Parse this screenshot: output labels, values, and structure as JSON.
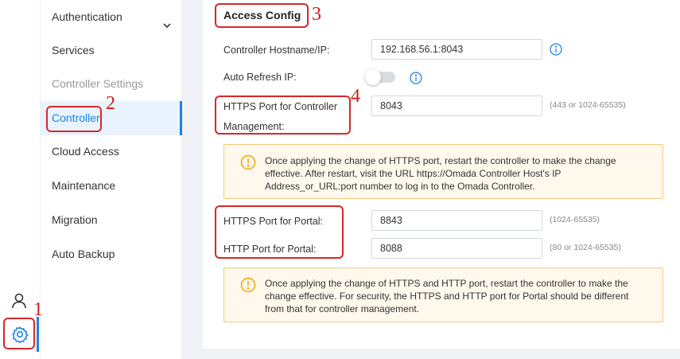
{
  "colors": {
    "accent": "#1d82e6",
    "annotation": "#d62828",
    "warning_bg": "#fff8ec",
    "warning_border": "#f5c979",
    "warning_icon": "#f0a500"
  },
  "rail": {
    "user_icon": "user-icon",
    "settings_icon": "gear-icon"
  },
  "submenu": {
    "items": [
      {
        "label": "Authentication",
        "has_chevron": true
      },
      {
        "label": "Services"
      },
      {
        "label": "Controller Settings",
        "group": true
      },
      {
        "label": "Controller",
        "active": true
      },
      {
        "label": "Cloud Access"
      },
      {
        "label": "Maintenance"
      },
      {
        "label": "Migration"
      },
      {
        "label": "Auto Backup"
      }
    ]
  },
  "access_config": {
    "title": "Access Config",
    "hostname": {
      "label": "Controller Hostname/IP:",
      "value": "192.168.56.1:8043"
    },
    "auto_refresh": {
      "label": "Auto Refresh IP:",
      "enabled": false
    },
    "https_controller": {
      "label_line1": "HTTPS Port for Controller",
      "label_line2": "Management:",
      "value": "8043",
      "range": "(443 or 1024-65535)"
    },
    "warning1": "Once applying the change of HTTPS port, restart the controller to make the change effective. After restart, visit the URL https://Omada Controller Host's IP Address_or_URL:port number to log in to the Omada Controller.",
    "https_portal": {
      "label": "HTTPS Port for Portal:",
      "value": "8843",
      "range": "(1024-65535)"
    },
    "http_portal": {
      "label": "HTTP Port for Portal:",
      "value": "8088",
      "range": "(80 or 1024-65535)"
    },
    "warning2": "Once applying the change of HTTPS and HTTP port, restart the controller to make the change effective. For security, the HTTPS and HTTP port for Portal should be different from that for controller management."
  },
  "annotations": [
    "1",
    "2",
    "3",
    "4"
  ]
}
